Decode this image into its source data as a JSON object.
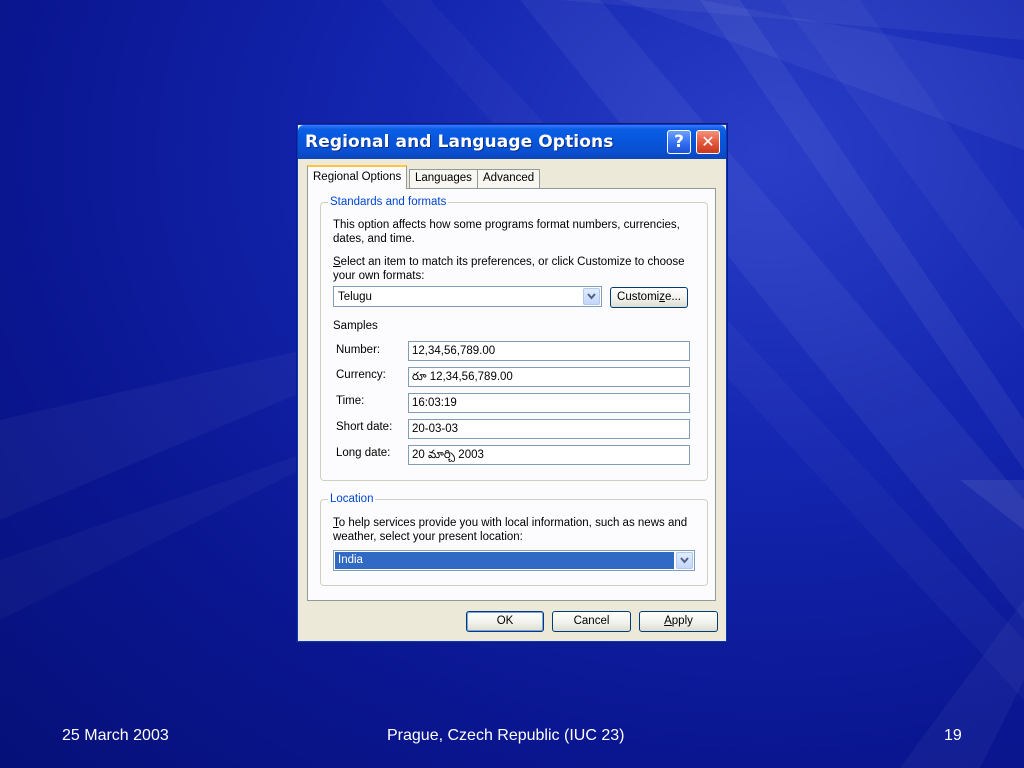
{
  "slide": {
    "footer_date": "25 March 2003",
    "footer_venue": "Prague, Czech Republic (IUC 23)",
    "page_number": "19"
  },
  "dialog": {
    "title": "Regional and Language Options",
    "help_label": "?",
    "close_label": "✕",
    "tabs": [
      {
        "label": "Regional Options",
        "active": true
      },
      {
        "label": "Languages",
        "active": false
      },
      {
        "label": "Advanced",
        "active": false
      }
    ],
    "standards": {
      "legend": "Standards and formats",
      "description": "This option affects how some programs format numbers, currencies, dates, and time.",
      "select_prompt_key": "S",
      "select_prompt_rest": "elect an item to match its preferences, or click Customize to choose your own formats:",
      "selected_format": "Telugu",
      "customize_pre": "Customi",
      "customize_key": "z",
      "customize_post": "e...",
      "samples_heading": "Samples",
      "samples": [
        {
          "label": "Number:",
          "value": "12,34,56,789.00"
        },
        {
          "label": "Currency:",
          "value": "రూ 12,34,56,789.00"
        },
        {
          "label": "Time:",
          "value": "16:03:19"
        },
        {
          "label": "Short date:",
          "value": "20-03-03"
        },
        {
          "label": "Long date:",
          "value": "20 మార్చి 2003"
        }
      ]
    },
    "location": {
      "legend": "Location",
      "description_key": "T",
      "description_rest": "o help services provide you with local information, such as news and weather, select your present location:",
      "selected_location": "India"
    },
    "buttons": {
      "ok": "OK",
      "cancel": "Cancel",
      "apply_key": "A",
      "apply_rest": "pply"
    }
  },
  "colors": {
    "background": "#0a1690",
    "titlebar": "#0756dc",
    "selection": "#316ac5",
    "legend_text": "#0046d5"
  }
}
